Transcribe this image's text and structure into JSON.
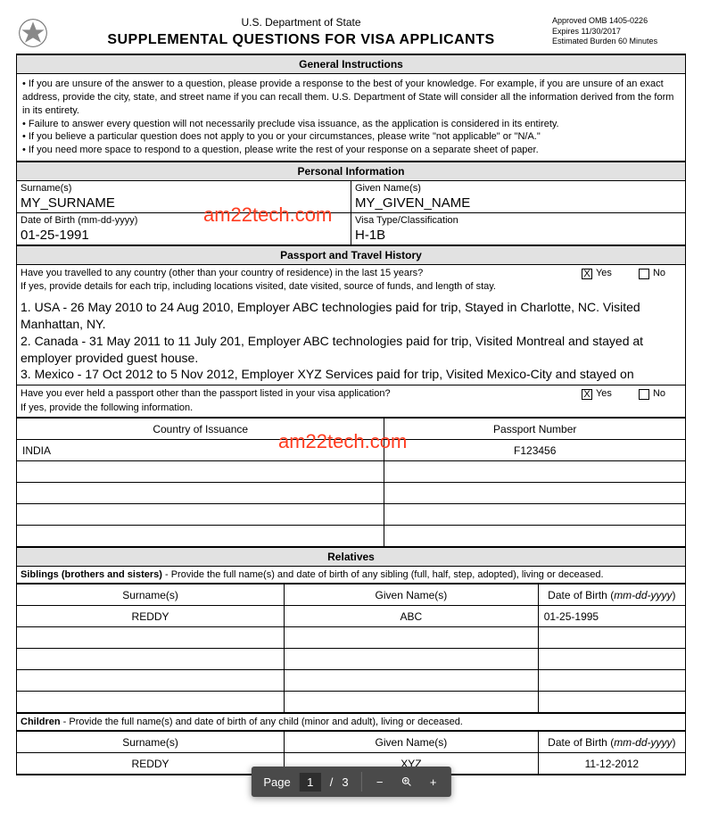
{
  "header": {
    "department": "U.S. Department of State",
    "title": "SUPPLEMENTAL QUESTIONS FOR VISA APPLICANTS",
    "omb_line1": "Approved OMB 1405-0226",
    "omb_line2": "Expires 11/30/2017",
    "omb_line3": "Estimated Burden 60 Minutes"
  },
  "sections": {
    "general_instructions": "General Instructions",
    "personal_info": "Personal Information",
    "passport_travel": "Passport and Travel History",
    "relatives": "Relatives"
  },
  "instructions": {
    "l1": "•  If you are unsure of the answer to a question, please provide a response to the best of your knowledge. For example, if you are unsure of an exact address, provide the city, state, and street name if you can recall them. U.S. Department of State will consider all the information derived from the form in its entirety.",
    "l2": "•  Failure to answer every question will not necessarily preclude visa issuance, as the application is considered in its entirety.",
    "l3": "•  If you believe a particular question does not apply to you or your circumstances, please write \"not applicable\" or \"N/A.\"",
    "l4": "•  If you need more space to respond to a question, please write the rest of your response on a separate sheet of paper."
  },
  "personal": {
    "surname_label": "Surname(s)",
    "surname_value": "MY_SURNAME",
    "given_label": "Given Name(s)",
    "given_value": "MY_GIVEN_NAME",
    "dob_label": "Date of Birth (mm-dd-yyyy)",
    "dob_value": "01-25-1991",
    "visa_label": "Visa Type/Classification",
    "visa_value": "H-1B"
  },
  "travel": {
    "q1": "Have you travelled to any country (other than your country of residence) in the last 15 years?",
    "q1_sub": "If yes, provide details for each trip, including locations visited, date visited, source of funds, and length of stay.",
    "q1_answer_l1": "1. USA - 26 May 2010 to 24 Aug 2010, Employer ABC technologies paid for trip, Stayed in Charlotte, NC. Visited Manhattan, NY.",
    "q1_answer_l2": "2. Canada - 31 May 2011 to 11 July 201, Employer ABC technologies paid for trip, Visited Montreal and stayed at employer provided guest house.",
    "q1_answer_l3": "3. Mexico - 17 Oct 2012 to 5 Nov 2012, Employer XYZ Services paid for trip, Visited Mexico-City and stayed on",
    "q2": "Have you ever held a passport other than the passport listed in your visa application?",
    "q2_sub": "If yes, provide the following information.",
    "yes": "Yes",
    "no": "No",
    "chk_mark": "X"
  },
  "passport_table": {
    "col_country": "Country of Issuance",
    "col_number": "Passport Number",
    "rows": [
      {
        "country": "INDIA",
        "number": "F123456"
      },
      {
        "country": "",
        "number": ""
      },
      {
        "country": "",
        "number": ""
      },
      {
        "country": "",
        "number": ""
      },
      {
        "country": "",
        "number": ""
      }
    ]
  },
  "siblings": {
    "intro_bold": "Siblings (brothers and sisters)",
    "intro_rest": " - Provide the full name(s) and date of birth of any sibling (full, half, step, adopted), living or deceased.",
    "col_surname": "Surname(s)",
    "col_given": "Given Name(s)",
    "col_dob_prefix": "Date of Birth (",
    "col_dob_italic": "mm-dd-yyyy",
    "col_dob_suffix": ")",
    "rows": [
      {
        "surname": "REDDY",
        "given": "ABC",
        "dob": "01-25-1995"
      },
      {
        "surname": "",
        "given": "",
        "dob": ""
      },
      {
        "surname": "",
        "given": "",
        "dob": ""
      },
      {
        "surname": "",
        "given": "",
        "dob": ""
      },
      {
        "surname": "",
        "given": "",
        "dob": ""
      }
    ]
  },
  "children": {
    "intro_bold": "Children",
    "intro_rest": " - Provide the full name(s) and date of birth of any child (minor and adult), living or deceased.",
    "col_surname": "Surname(s)",
    "col_given": "Given Name(s)",
    "col_dob_prefix": "Date of Birth (",
    "col_dob_italic": "mm-dd-yyyy",
    "col_dob_suffix": ")",
    "rows": [
      {
        "surname": "REDDY",
        "given": "XYZ",
        "dob": "11-12-2012"
      }
    ]
  },
  "watermark": "am22tech.com",
  "toolbar": {
    "page_label": "Page",
    "current": "1",
    "sep": "/",
    "total": "3",
    "minus": "−",
    "plus": "+"
  }
}
